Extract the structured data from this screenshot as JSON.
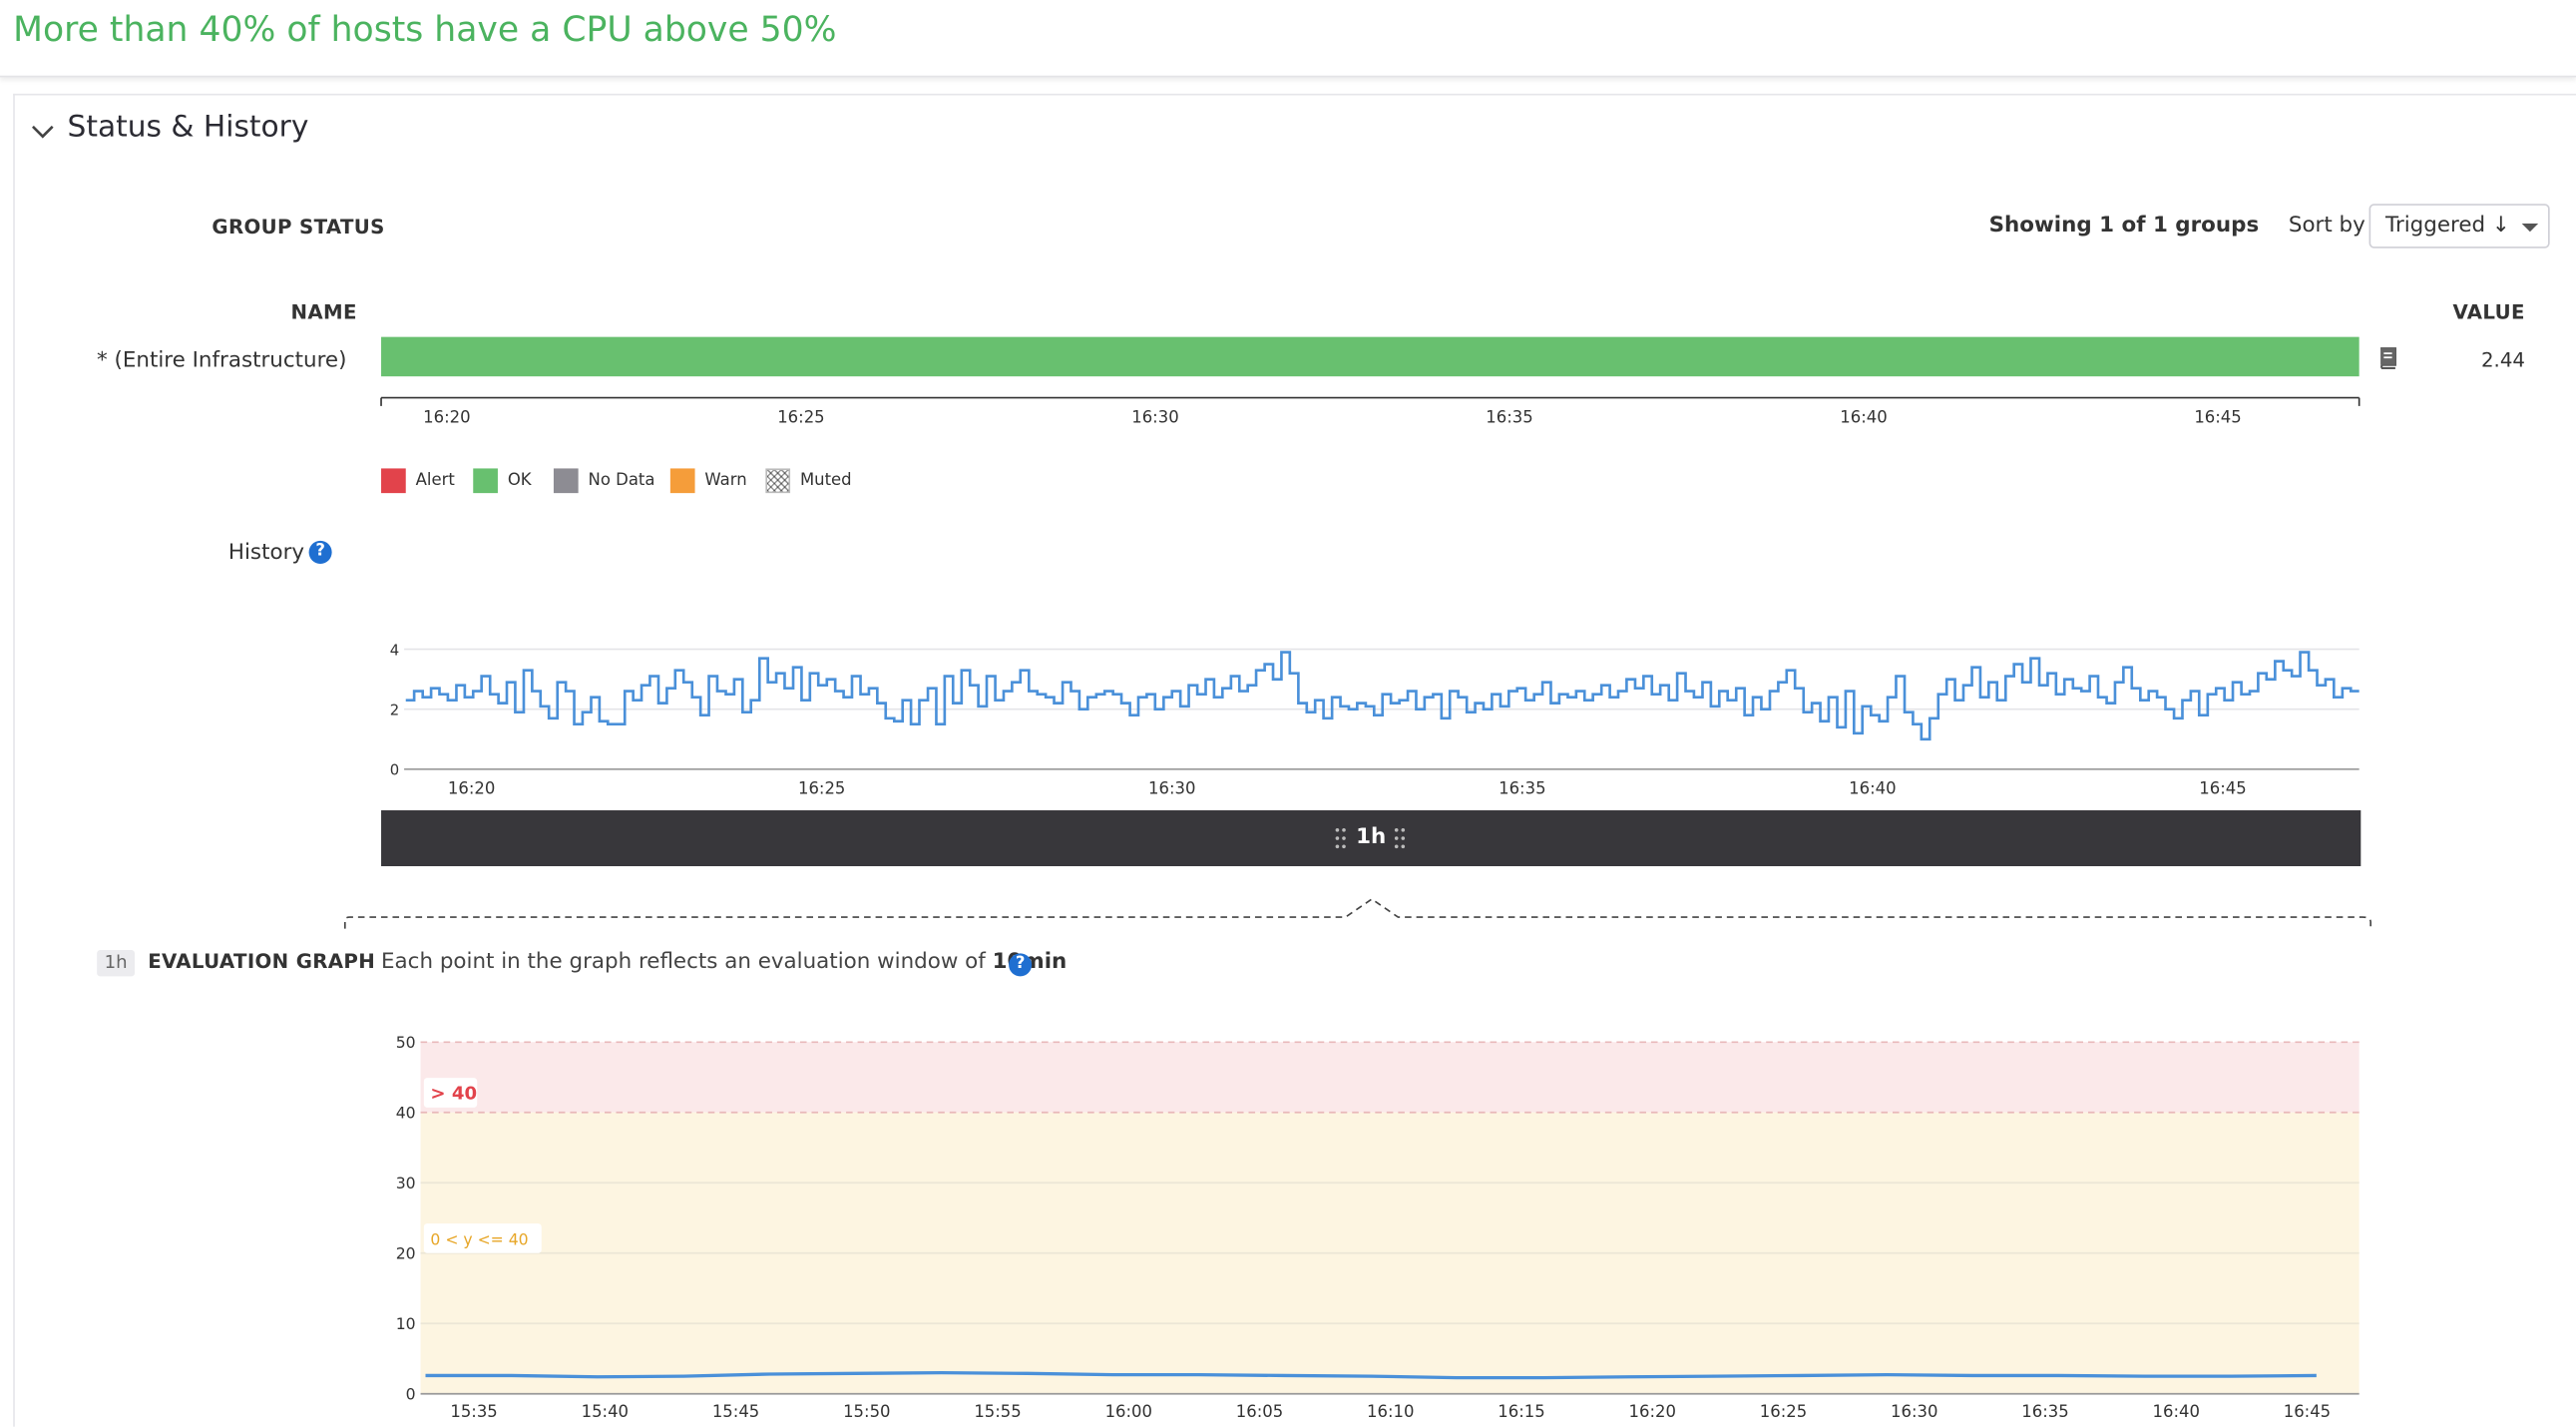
{
  "monitor": {
    "title": "More than 40% of hosts have a CPU above 50%"
  },
  "section": {
    "title": "Status & History"
  },
  "group_status": {
    "heading": "GROUP STATUS",
    "showing": "Showing 1 of 1 groups",
    "sort_label": "Sort by",
    "sort_value": "Triggered ↓",
    "name_header": "NAME",
    "value_header": "VALUE",
    "groups": [
      {
        "name": "* (Entire Infrastructure)",
        "value": "2.44",
        "status": "OK",
        "status_fraction_ok": 1.0
      }
    ],
    "time_ticks": [
      "16:20",
      "16:25",
      "16:30",
      "16:35",
      "16:40",
      "16:45"
    ]
  },
  "legend": [
    {
      "label": "Alert",
      "color": "#e2434b"
    },
    {
      "label": "OK",
      "color": "#68c06f"
    },
    {
      "label": "No Data",
      "color": "#8d8c93"
    },
    {
      "label": "Warn",
      "color": "#f59d3a"
    },
    {
      "label": "Muted",
      "color": "pattern"
    }
  ],
  "history": {
    "label": "History",
    "help": "?",
    "range_label": "1h",
    "chart_data": {
      "type": "line",
      "y_ticks": [
        "0",
        "2",
        "4"
      ],
      "x_ticks": [
        "16:20",
        "16:25",
        "16:30",
        "16:35",
        "16:40",
        "16:45"
      ],
      "ylim": [
        0,
        4
      ],
      "x_range": [
        "16:18",
        "16:47"
      ],
      "series": [
        {
          "color": "#4a90d9",
          "values": [
            2.3,
            2.6,
            2.4,
            2.7,
            2.5,
            2.3,
            2.8,
            2.4,
            2.6,
            3.1,
            2.5,
            2.2,
            2.9,
            1.9,
            3.3,
            2.6,
            2.1,
            1.7,
            2.9,
            2.6,
            1.5,
            1.9,
            2.4,
            1.6,
            1.5,
            1.5,
            2.6,
            2.3,
            2.8,
            3.1,
            2.2,
            2.7,
            3.3,
            2.9,
            2.4,
            1.8,
            3.1,
            2.6,
            2.5,
            3.0,
            1.9,
            2.3,
            3.7,
            2.9,
            3.2,
            2.7,
            3.4,
            2.3,
            3.2,
            2.8,
            3.0,
            2.6,
            2.4,
            3.1,
            2.5,
            2.7,
            2.2,
            1.7,
            1.6,
            2.3,
            1.5,
            2.3,
            2.7,
            1.5,
            3.1,
            2.2,
            3.3,
            2.8,
            2.1,
            3.1,
            2.3,
            2.6,
            2.9,
            3.3,
            2.6,
            2.5,
            2.4,
            2.2,
            2.9,
            2.6,
            2.0,
            2.4,
            2.5,
            2.6,
            2.5,
            2.2,
            1.8,
            2.4,
            2.5,
            2.0,
            2.4,
            2.6,
            2.1,
            2.8,
            2.5,
            3.0,
            2.4,
            2.7,
            3.1,
            2.6,
            2.8,
            3.3,
            3.5,
            3.0,
            3.9,
            3.2,
            2.2,
            1.9,
            2.3,
            1.7,
            2.4,
            2.1,
            2.0,
            2.2,
            2.1,
            1.8,
            2.5,
            2.2,
            2.3,
            2.6,
            2.0,
            2.4,
            2.5,
            1.7,
            2.6,
            2.4,
            1.9,
            2.2,
            2.0,
            2.5,
            2.1,
            2.6,
            2.7,
            2.3,
            2.5,
            2.9,
            2.2,
            2.5,
            2.4,
            2.6,
            2.3,
            2.5,
            2.8,
            2.4,
            2.6,
            3.0,
            2.7,
            3.1,
            2.5,
            2.8,
            2.3,
            3.2,
            2.6,
            2.4,
            2.9,
            2.1,
            2.6,
            2.3,
            2.7,
            1.8,
            2.4,
            2.0,
            2.6,
            2.9,
            3.3,
            2.7,
            1.9,
            2.2,
            1.6,
            2.4,
            1.4,
            2.6,
            1.2,
            2.1,
            1.8,
            1.6,
            2.4,
            3.1,
            1.9,
            1.5,
            1.0,
            1.7,
            2.5,
            3.0,
            2.3,
            2.8,
            3.4,
            2.4,
            2.9,
            2.3,
            3.1,
            3.5,
            2.9,
            3.7,
            2.8,
            3.2,
            2.5,
            3.0,
            2.7,
            2.6,
            3.1,
            2.4,
            2.2,
            2.9,
            3.4,
            2.7,
            2.3,
            2.6,
            2.4,
            2.0,
            1.7,
            2.3,
            2.6,
            1.8,
            2.5,
            2.7,
            2.3,
            2.9,
            2.5,
            2.6,
            3.2,
            3.0,
            3.6,
            3.3,
            3.1,
            3.9,
            3.3,
            2.8,
            3.0,
            2.4,
            2.7,
            2.6,
            2.6
          ]
        }
      ]
    }
  },
  "evaluation": {
    "badge": "1h",
    "title": "EVALUATION GRAPH",
    "description": "Each point in the graph reflects an evaluation window of",
    "window": "10min",
    "help": "?",
    "chart_data": {
      "type": "line",
      "y_ticks": [
        "0",
        "10",
        "20",
        "30",
        "40",
        "50"
      ],
      "x_ticks": [
        "15:35",
        "15:40",
        "15:45",
        "15:50",
        "15:55",
        "16:00",
        "16:05",
        "16:10",
        "16:15",
        "16:20",
        "16:25",
        "16:30",
        "16:35",
        "16:40",
        "16:45"
      ],
      "ylim": [
        0,
        50
      ],
      "thresholds": [
        {
          "label": "> 40",
          "from": 40,
          "to": 50,
          "color": "#fbe9ea",
          "text_color": "#e2434b"
        },
        {
          "label": "0 < y <= 40",
          "from": 0,
          "to": 40,
          "color": "#fdf5e1",
          "text_color": "#e7a627"
        }
      ],
      "series": [
        {
          "color": "#4a90d9",
          "values": [
            2.6,
            2.6,
            2.4,
            2.5,
            2.8,
            2.9,
            3.0,
            2.9,
            2.7,
            2.7,
            2.6,
            2.5,
            2.3,
            2.3,
            2.4,
            2.5,
            2.6,
            2.7,
            2.6,
            2.6,
            2.5,
            2.5,
            2.6
          ]
        }
      ]
    }
  }
}
